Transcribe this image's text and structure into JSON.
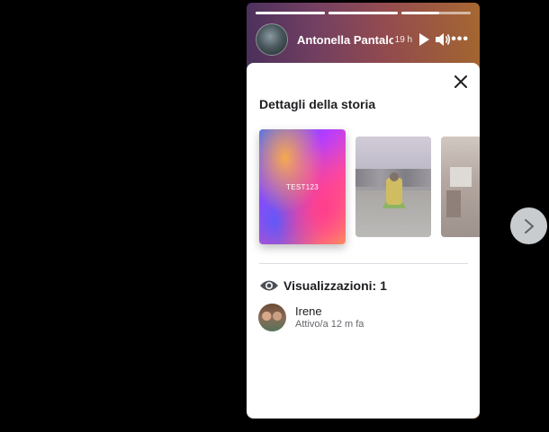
{
  "story": {
    "author_name": "Antonella Pantalone",
    "time": "19 h",
    "progress": [
      1,
      1,
      0.55
    ]
  },
  "details": {
    "title": "Dettagli della storia",
    "thumbnails": [
      {
        "label": "TEST123"
      }
    ],
    "views_label": "Visualizzazioni: 1",
    "viewers": [
      {
        "name": "Irene",
        "status": "Attivo/a 12 m fa"
      }
    ]
  },
  "icons": {
    "close": "close-icon",
    "eye": "eye-icon",
    "next": "chevron-right-icon",
    "play": "play-icon",
    "volume": "volume-icon",
    "more": "more-icon"
  },
  "colors": {
    "panel": "#ffffff",
    "text": "#1c1e21",
    "muted": "#65676b",
    "next_button": "#c9cccf"
  }
}
